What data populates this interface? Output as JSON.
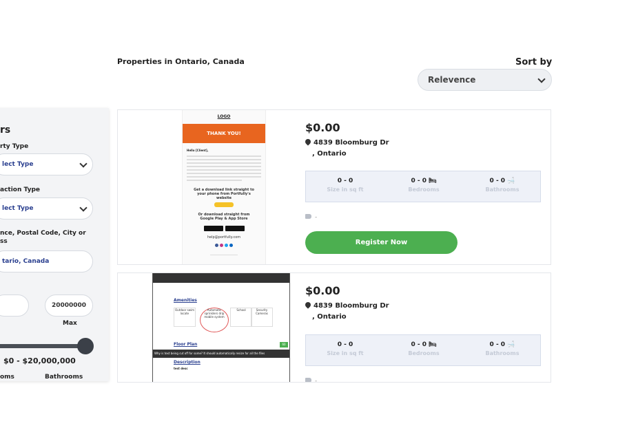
{
  "header": {
    "heading": "Properties in Ontario, Canada",
    "sort_label": "Sort by",
    "sort_value": "Relevence"
  },
  "filters": {
    "title": "rs",
    "property_type_label": "rty Type",
    "property_type_value": "lect Type",
    "transaction_type_label": "action Type",
    "transaction_type_value": "lect Type",
    "location_label": "nce, Postal Code, City or\nss",
    "location_value": "tario, Canada",
    "price_max_value": "20000000",
    "price_max_label": "Max",
    "price_range": "$0 - $20,000,000",
    "bedrooms_label": "oms",
    "bathrooms_label": "Bathrooms"
  },
  "listings": [
    {
      "price": "$0.00",
      "address_line1": "4839 Bloomburg Dr",
      "address_line2": ", Ontario",
      "size_value": "0 - 0",
      "size_label": "Size in sq ft",
      "bedrooms_value": "0 - 0",
      "bedrooms_label": "Bedrooms",
      "bathrooms_value": "0 - 0",
      "bathrooms_label": "Bathrooms",
      "tag_text": "-",
      "register_label": "Register Now",
      "thumb": {
        "logo": "LOGO",
        "banner": "THANK YOU!",
        "greeting": "Hello [Client],",
        "cta_text": "Get a download link straight to your phone from Portfully's website",
        "download_text": "Or download straight from Google Play & App Store",
        "email": "help@portfully.com"
      }
    },
    {
      "price": "$0.00",
      "address_line1": "4839 Bloomburg Dr",
      "address_line2": ", Ontario",
      "size_value": "0 - 0",
      "size_label": "Size in sq ft",
      "bedrooms_value": "0 - 0",
      "bedrooms_label": "Bedrooms",
      "bathrooms_value": "0 - 0",
      "bathrooms_label": "Bathrooms",
      "tag_text": "-",
      "thumb": {
        "amenities": "Amenities",
        "amenity_1": "Outdoor swim locate",
        "amenity_2": "Automatic sprinklers drip mobile system",
        "amenity_3": "School",
        "amenity_4": "Security Cameras",
        "floor_plan": "Floor Plan",
        "floor_plan_badge": "60",
        "bar_text": "Why is text being cut off for some? It should automatically resize for all the files",
        "description": "Description",
        "desc_body": "test desc"
      }
    }
  ],
  "colors": {
    "accent_green": "#4caf50",
    "banner_orange": "#e8651f",
    "link_blue": "#2a3f8f"
  }
}
